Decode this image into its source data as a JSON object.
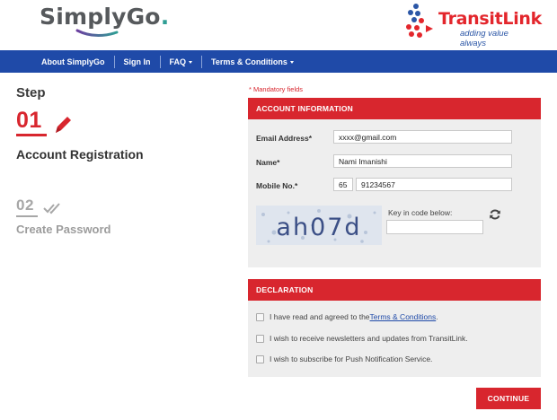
{
  "header": {
    "brand": "SimplyGo",
    "brand_suffix": ".",
    "partner_name": "TransitLink",
    "partner_tagline": "adding value always"
  },
  "nav": {
    "items": [
      {
        "label": "About SimplyGo"
      },
      {
        "label": "Sign In"
      },
      {
        "label": "FAQ"
      },
      {
        "label": "Terms & Conditions"
      }
    ]
  },
  "steps": {
    "title": "Step",
    "current": {
      "number": "01",
      "label": "Account Registration"
    },
    "next": {
      "number": "02",
      "label": "Create Password"
    }
  },
  "form": {
    "mandatory_note": "* Mandatory fields",
    "account_heading": "ACCOUNT INFORMATION",
    "email_label": "Email Address*",
    "email_value": "xxxx@gmail.com",
    "name_label": "Name*",
    "name_value": "Nami Imanishi",
    "mobile_label": "Mobile No.*",
    "country_code": "65",
    "mobile_value": "91234567",
    "captcha_text": "ah07d",
    "captcha_prompt": "Key in code below:",
    "captcha_input": "",
    "declaration_heading": "DECLARATION",
    "decl_1_pre": "I have read and agreed to the ",
    "decl_1_link": "Terms & Conditions",
    "decl_1_post": ".",
    "decl_2": "I wish to receive newsletters and updates from TransitLink.",
    "decl_3": "I wish to subscribe for Push Notification Service.",
    "continue_label": "CONTINUE"
  },
  "colors": {
    "accent_red": "#d8262e",
    "nav_blue": "#1f4aa8",
    "panel_bg": "#eeeeee"
  },
  "icons": {
    "edit": "pencil-icon",
    "done": "double-check-icon",
    "refresh": "refresh-icon"
  }
}
